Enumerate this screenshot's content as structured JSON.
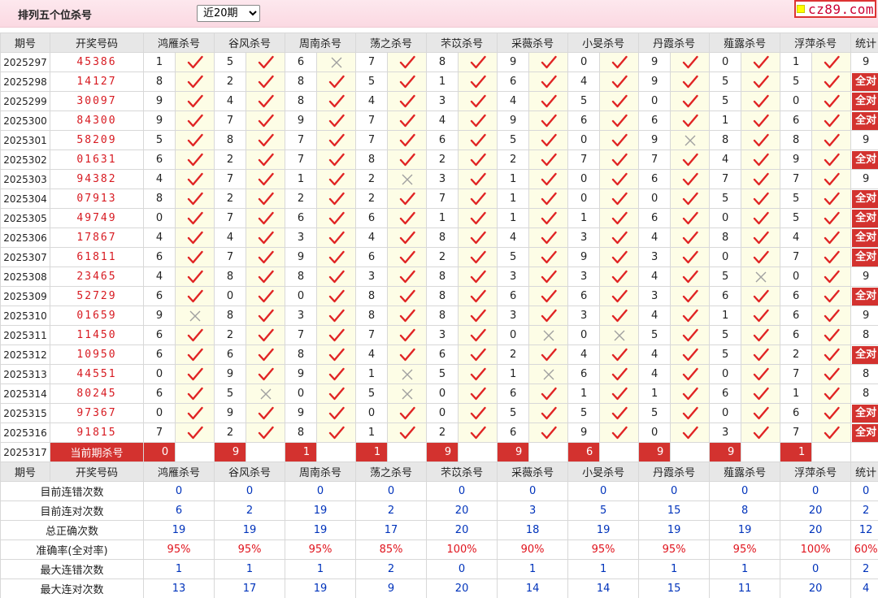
{
  "header": {
    "title": "排列五个位杀号",
    "period_select": "近20期",
    "period_options": [
      "近20期"
    ],
    "logo_text": "cz89.com"
  },
  "colors": {
    "accent_red": "#d3322f",
    "number_red": "#d71920",
    "blue": "#0033bb",
    "mark_bg": "#fdfde6"
  },
  "columns": {
    "issue": "期号",
    "draw": "开奖号码",
    "methods": [
      "鸿雁杀号",
      "谷风杀号",
      "周南杀号",
      "荡之杀号",
      "芣苡杀号",
      "采薇杀号",
      "小旻杀号",
      "丹霞杀号",
      "薤露杀号",
      "浮萍杀号"
    ],
    "stat": "统计"
  },
  "rows": [
    {
      "issue": "2025297",
      "draw": "45386",
      "kills": [
        "1",
        "5",
        "6",
        "7",
        "8",
        "9",
        "0",
        "9",
        "0",
        "1"
      ],
      "hits": [
        1,
        1,
        0,
        1,
        1,
        1,
        1,
        1,
        1,
        1
      ],
      "stat": "9"
    },
    {
      "issue": "2025298",
      "draw": "14127",
      "kills": [
        "8",
        "2",
        "8",
        "5",
        "1",
        "6",
        "4",
        "9",
        "5",
        "5"
      ],
      "hits": [
        1,
        1,
        1,
        1,
        1,
        1,
        1,
        1,
        1,
        1
      ],
      "stat": "全对"
    },
    {
      "issue": "2025299",
      "draw": "30097",
      "kills": [
        "9",
        "4",
        "8",
        "4",
        "3",
        "4",
        "5",
        "0",
        "5",
        "0"
      ],
      "hits": [
        1,
        1,
        1,
        1,
        1,
        1,
        1,
        1,
        1,
        1
      ],
      "stat": "全对"
    },
    {
      "issue": "2025300",
      "draw": "84300",
      "kills": [
        "9",
        "7",
        "9",
        "7",
        "4",
        "9",
        "6",
        "6",
        "1",
        "6"
      ],
      "hits": [
        1,
        1,
        1,
        1,
        1,
        1,
        1,
        1,
        1,
        1
      ],
      "stat": "全对"
    },
    {
      "issue": "2025301",
      "draw": "58209",
      "kills": [
        "5",
        "8",
        "7",
        "7",
        "6",
        "5",
        "0",
        "9",
        "8",
        "8"
      ],
      "hits": [
        1,
        1,
        1,
        1,
        1,
        1,
        1,
        0,
        1,
        1
      ],
      "stat": "9"
    },
    {
      "issue": "2025302",
      "draw": "01631",
      "kills": [
        "6",
        "2",
        "7",
        "8",
        "2",
        "2",
        "7",
        "7",
        "4",
        "9"
      ],
      "hits": [
        1,
        1,
        1,
        1,
        1,
        1,
        1,
        1,
        1,
        1
      ],
      "stat": "全对"
    },
    {
      "issue": "2025303",
      "draw": "94382",
      "kills": [
        "4",
        "7",
        "1",
        "2",
        "3",
        "1",
        "0",
        "6",
        "7",
        "7"
      ],
      "hits": [
        1,
        1,
        1,
        0,
        1,
        1,
        1,
        1,
        1,
        1
      ],
      "stat": "9"
    },
    {
      "issue": "2025304",
      "draw": "07913",
      "kills": [
        "8",
        "2",
        "2",
        "2",
        "7",
        "1",
        "0",
        "0",
        "5",
        "5"
      ],
      "hits": [
        1,
        1,
        1,
        1,
        1,
        1,
        1,
        1,
        1,
        1
      ],
      "stat": "全对"
    },
    {
      "issue": "2025305",
      "draw": "49749",
      "kills": [
        "0",
        "7",
        "6",
        "6",
        "1",
        "1",
        "1",
        "6",
        "0",
        "5"
      ],
      "hits": [
        1,
        1,
        1,
        1,
        1,
        1,
        1,
        1,
        1,
        1
      ],
      "stat": "全对"
    },
    {
      "issue": "2025306",
      "draw": "17867",
      "kills": [
        "4",
        "4",
        "3",
        "4",
        "8",
        "4",
        "3",
        "4",
        "8",
        "4"
      ],
      "hits": [
        1,
        1,
        1,
        1,
        1,
        1,
        1,
        1,
        1,
        1
      ],
      "stat": "全对"
    },
    {
      "issue": "2025307",
      "draw": "61811",
      "kills": [
        "6",
        "7",
        "9",
        "6",
        "2",
        "5",
        "9",
        "3",
        "0",
        "7"
      ],
      "hits": [
        1,
        1,
        1,
        1,
        1,
        1,
        1,
        1,
        1,
        1
      ],
      "stat": "全对"
    },
    {
      "issue": "2025308",
      "draw": "23465",
      "kills": [
        "4",
        "8",
        "8",
        "3",
        "8",
        "3",
        "3",
        "4",
        "5",
        "0"
      ],
      "hits": [
        1,
        1,
        1,
        1,
        1,
        1,
        1,
        1,
        0,
        1
      ],
      "stat": "9"
    },
    {
      "issue": "2025309",
      "draw": "52729",
      "kills": [
        "6",
        "0",
        "0",
        "8",
        "8",
        "6",
        "6",
        "3",
        "6",
        "6"
      ],
      "hits": [
        1,
        1,
        1,
        1,
        1,
        1,
        1,
        1,
        1,
        1
      ],
      "stat": "全对"
    },
    {
      "issue": "2025310",
      "draw": "01659",
      "kills": [
        "9",
        "8",
        "3",
        "8",
        "8",
        "3",
        "3",
        "4",
        "1",
        "6"
      ],
      "hits": [
        0,
        1,
        1,
        1,
        1,
        1,
        1,
        1,
        1,
        1
      ],
      "stat": "9"
    },
    {
      "issue": "2025311",
      "draw": "11450",
      "kills": [
        "6",
        "2",
        "7",
        "7",
        "3",
        "0",
        "0",
        "5",
        "5",
        "6"
      ],
      "hits": [
        1,
        1,
        1,
        1,
        1,
        0,
        0,
        1,
        1,
        1
      ],
      "stat": "8"
    },
    {
      "issue": "2025312",
      "draw": "10950",
      "kills": [
        "6",
        "6",
        "8",
        "4",
        "6",
        "2",
        "4",
        "4",
        "5",
        "2"
      ],
      "hits": [
        1,
        1,
        1,
        1,
        1,
        1,
        1,
        1,
        1,
        1
      ],
      "stat": "全对"
    },
    {
      "issue": "2025313",
      "draw": "44551",
      "kills": [
        "0",
        "9",
        "9",
        "1",
        "5",
        "1",
        "6",
        "4",
        "0",
        "7"
      ],
      "hits": [
        1,
        1,
        1,
        0,
        1,
        0,
        1,
        1,
        1,
        1
      ],
      "stat": "8"
    },
    {
      "issue": "2025314",
      "draw": "80245",
      "kills": [
        "6",
        "5",
        "0",
        "5",
        "0",
        "6",
        "1",
        "1",
        "6",
        "1"
      ],
      "hits": [
        1,
        0,
        1,
        0,
        1,
        1,
        1,
        1,
        1,
        1
      ],
      "stat": "8"
    },
    {
      "issue": "2025315",
      "draw": "97367",
      "kills": [
        "0",
        "9",
        "9",
        "0",
        "0",
        "5",
        "5",
        "5",
        "0",
        "6"
      ],
      "hits": [
        1,
        1,
        1,
        1,
        1,
        1,
        1,
        1,
        1,
        1
      ],
      "stat": "全对"
    },
    {
      "issue": "2025316",
      "draw": "91815",
      "kills": [
        "7",
        "2",
        "8",
        "1",
        "2",
        "6",
        "9",
        "0",
        "3",
        "7"
      ],
      "hits": [
        1,
        1,
        1,
        1,
        1,
        1,
        1,
        1,
        1,
        1
      ],
      "stat": "全对"
    }
  ],
  "current": {
    "issue": "2025317",
    "label": "当前期杀号",
    "kills": [
      "0",
      "9",
      "1",
      "1",
      "9",
      "9",
      "6",
      "9",
      "9",
      "1"
    ]
  },
  "summary": [
    {
      "label": "目前连错次数",
      "style": "blue",
      "values": [
        "0",
        "0",
        "0",
        "0",
        "0",
        "0",
        "0",
        "0",
        "0",
        "0",
        "0"
      ]
    },
    {
      "label": "目前连对次数",
      "style": "blue",
      "values": [
        "6",
        "2",
        "19",
        "2",
        "20",
        "3",
        "5",
        "15",
        "8",
        "20",
        "2"
      ]
    },
    {
      "label": "总正确次数",
      "style": "blue",
      "values": [
        "19",
        "19",
        "19",
        "17",
        "20",
        "18",
        "19",
        "19",
        "19",
        "20",
        "12"
      ]
    },
    {
      "label": "准确率(全对率)",
      "style": "red",
      "values": [
        "95%",
        "95%",
        "95%",
        "85%",
        "100%",
        "90%",
        "95%",
        "95%",
        "95%",
        "100%",
        "60%"
      ]
    },
    {
      "label": "最大连错次数",
      "style": "blue",
      "values": [
        "1",
        "1",
        "1",
        "2",
        "0",
        "1",
        "1",
        "1",
        "1",
        "0",
        "2"
      ]
    },
    {
      "label": "最大连对次数",
      "style": "blue",
      "values": [
        "13",
        "17",
        "19",
        "9",
        "20",
        "14",
        "14",
        "15",
        "11",
        "20",
        "4"
      ]
    }
  ]
}
